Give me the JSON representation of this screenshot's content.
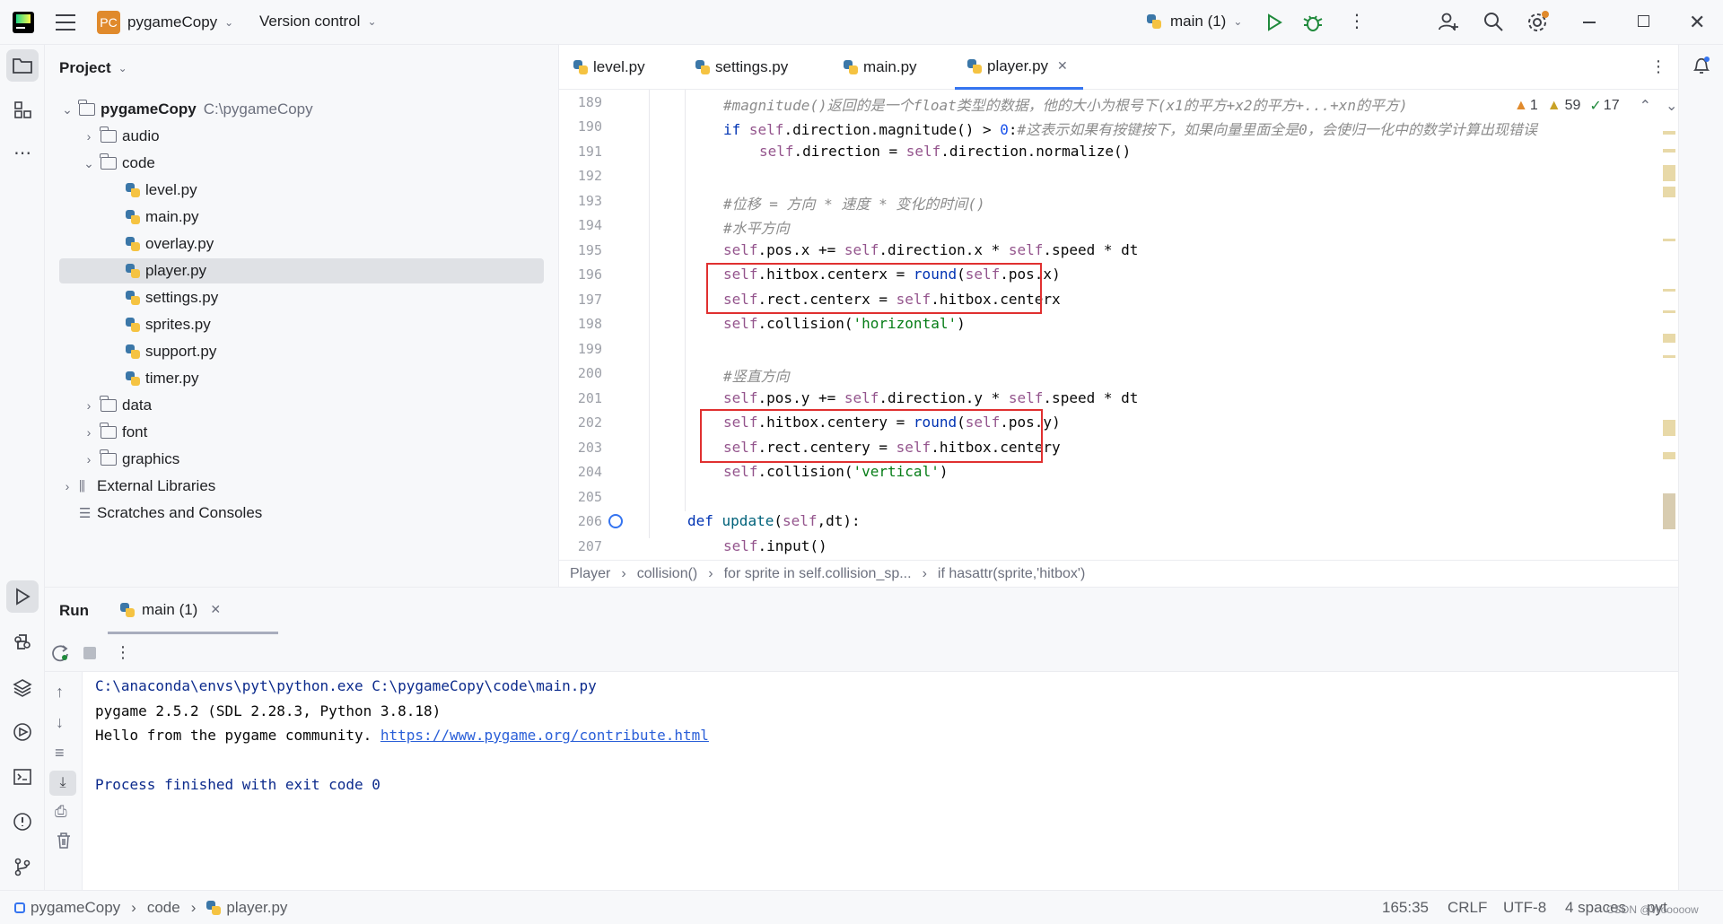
{
  "titlebar": {
    "app_badge": "PC",
    "project_name": "pygameCopy",
    "vcs_label": "Version control",
    "run_config": "main (1)"
  },
  "project_panel": {
    "title": "Project",
    "root_name": "pygameCopy",
    "root_path": "C:\\pygameCopy",
    "items": [
      {
        "label": "audio"
      },
      {
        "label": "code"
      },
      {
        "label": "level.py"
      },
      {
        "label": "main.py"
      },
      {
        "label": "overlay.py"
      },
      {
        "label": "player.py"
      },
      {
        "label": "settings.py"
      },
      {
        "label": "sprites.py"
      },
      {
        "label": "support.py"
      },
      {
        "label": "timer.py"
      },
      {
        "label": "data"
      },
      {
        "label": "font"
      },
      {
        "label": "graphics"
      },
      {
        "label": "External Libraries"
      },
      {
        "label": "Scratches and Consoles"
      }
    ]
  },
  "editor_tabs": [
    {
      "label": "level.py"
    },
    {
      "label": "settings.py"
    },
    {
      "label": "main.py"
    },
    {
      "label": "player.py"
    }
  ],
  "inspections": {
    "warn1": "1",
    "warn2": "59",
    "ok": "17"
  },
  "line_numbers": [
    "189",
    "190",
    "191",
    "192",
    "193",
    "194",
    "195",
    "196",
    "197",
    "198",
    "199",
    "200",
    "201",
    "202",
    "203",
    "204",
    "205",
    "206",
    "207"
  ],
  "code_lines": {
    "l189": "#magnitude()返回的是一个float类型的数据，他的大小为根号下(x1的平方+x2的平方+...+xn的平方)",
    "l190_kw": "if",
    "l190_a": " self",
    "l190_b": ".direction.magnitude() > ",
    "l190_c": "0",
    "l190_d": ":",
    "l190_cm": "#这表示如果有按键按下，如果向量里面全是0，会使归一化中的数学计算出现错误",
    "l191_a": "self",
    "l191_b": ".direction = ",
    "l191_c": "self",
    "l191_d": ".direction.normalize()",
    "l193": "#位移 = 方向 * 速度 * 变化的时间()",
    "l194": "#水平方向",
    "l195_a": "self",
    "l195_b": ".pos.x += ",
    "l195_c": "self",
    "l195_d": ".direction.x * ",
    "l195_e": "self",
    "l195_f": ".speed * dt",
    "l196_a": "self",
    "l196_b": ".hitbox.centerx = ",
    "l196_c": "round",
    "l196_d": "(",
    "l196_e": "self",
    "l196_f": ".pos.x)",
    "l197_a": "self",
    "l197_b": ".rect.centerx = ",
    "l197_c": "self",
    "l197_d": ".hitbox.centerx",
    "l198_a": "self",
    "l198_b": ".collision(",
    "l198_c": "'horizontal'",
    "l198_d": ")",
    "l200": "#竖直方向",
    "l201_a": "self",
    "l201_b": ".pos.y += ",
    "l201_c": "self",
    "l201_d": ".direction.y * ",
    "l201_e": "self",
    "l201_f": ".speed * dt",
    "l202_a": "self",
    "l202_b": ".hitbox.centery = ",
    "l202_c": "round",
    "l202_d": "(",
    "l202_e": "self",
    "l202_f": ".pos.y)",
    "l203_a": "self",
    "l203_b": ".rect.centery = ",
    "l203_c": "self",
    "l203_d": ".hitbox.centery",
    "l204_a": "self",
    "l204_b": ".collision(",
    "l204_c": "'vertical'",
    "l204_d": ")",
    "l206_kw": "def",
    "l206_fn": " update",
    "l206_a": "(",
    "l206_b": "self",
    "l206_c": ",dt):",
    "l207_a": "self",
    "l207_b": ".input()"
  },
  "breadcrumb": [
    "Player",
    "collision()",
    "for sprite in self.collision_sp...",
    "if hasattr(sprite,'hitbox')"
  ],
  "run_panel": {
    "title": "Run",
    "tab_label": "main (1)",
    "output": {
      "cmd": "C:\\anaconda\\envs\\pyt\\python.exe C:\\pygameCopy\\code\\main.py",
      "line2": "pygame 2.5.2 (SDL 2.28.3, Python 3.8.18)",
      "line3_text": "Hello from the pygame community. ",
      "line3_link": "https://www.pygame.org/contribute.html",
      "finished": "Process finished with exit code 0"
    }
  },
  "statusbar": {
    "path": [
      "pygameCopy",
      "code",
      "player.py"
    ],
    "position": "165:35",
    "line_sep": "CRLF",
    "encoding": "UTF-8",
    "indent": "4 spaces",
    "lang": "pyt",
    "watermark": "CSDN @Wooooow"
  }
}
